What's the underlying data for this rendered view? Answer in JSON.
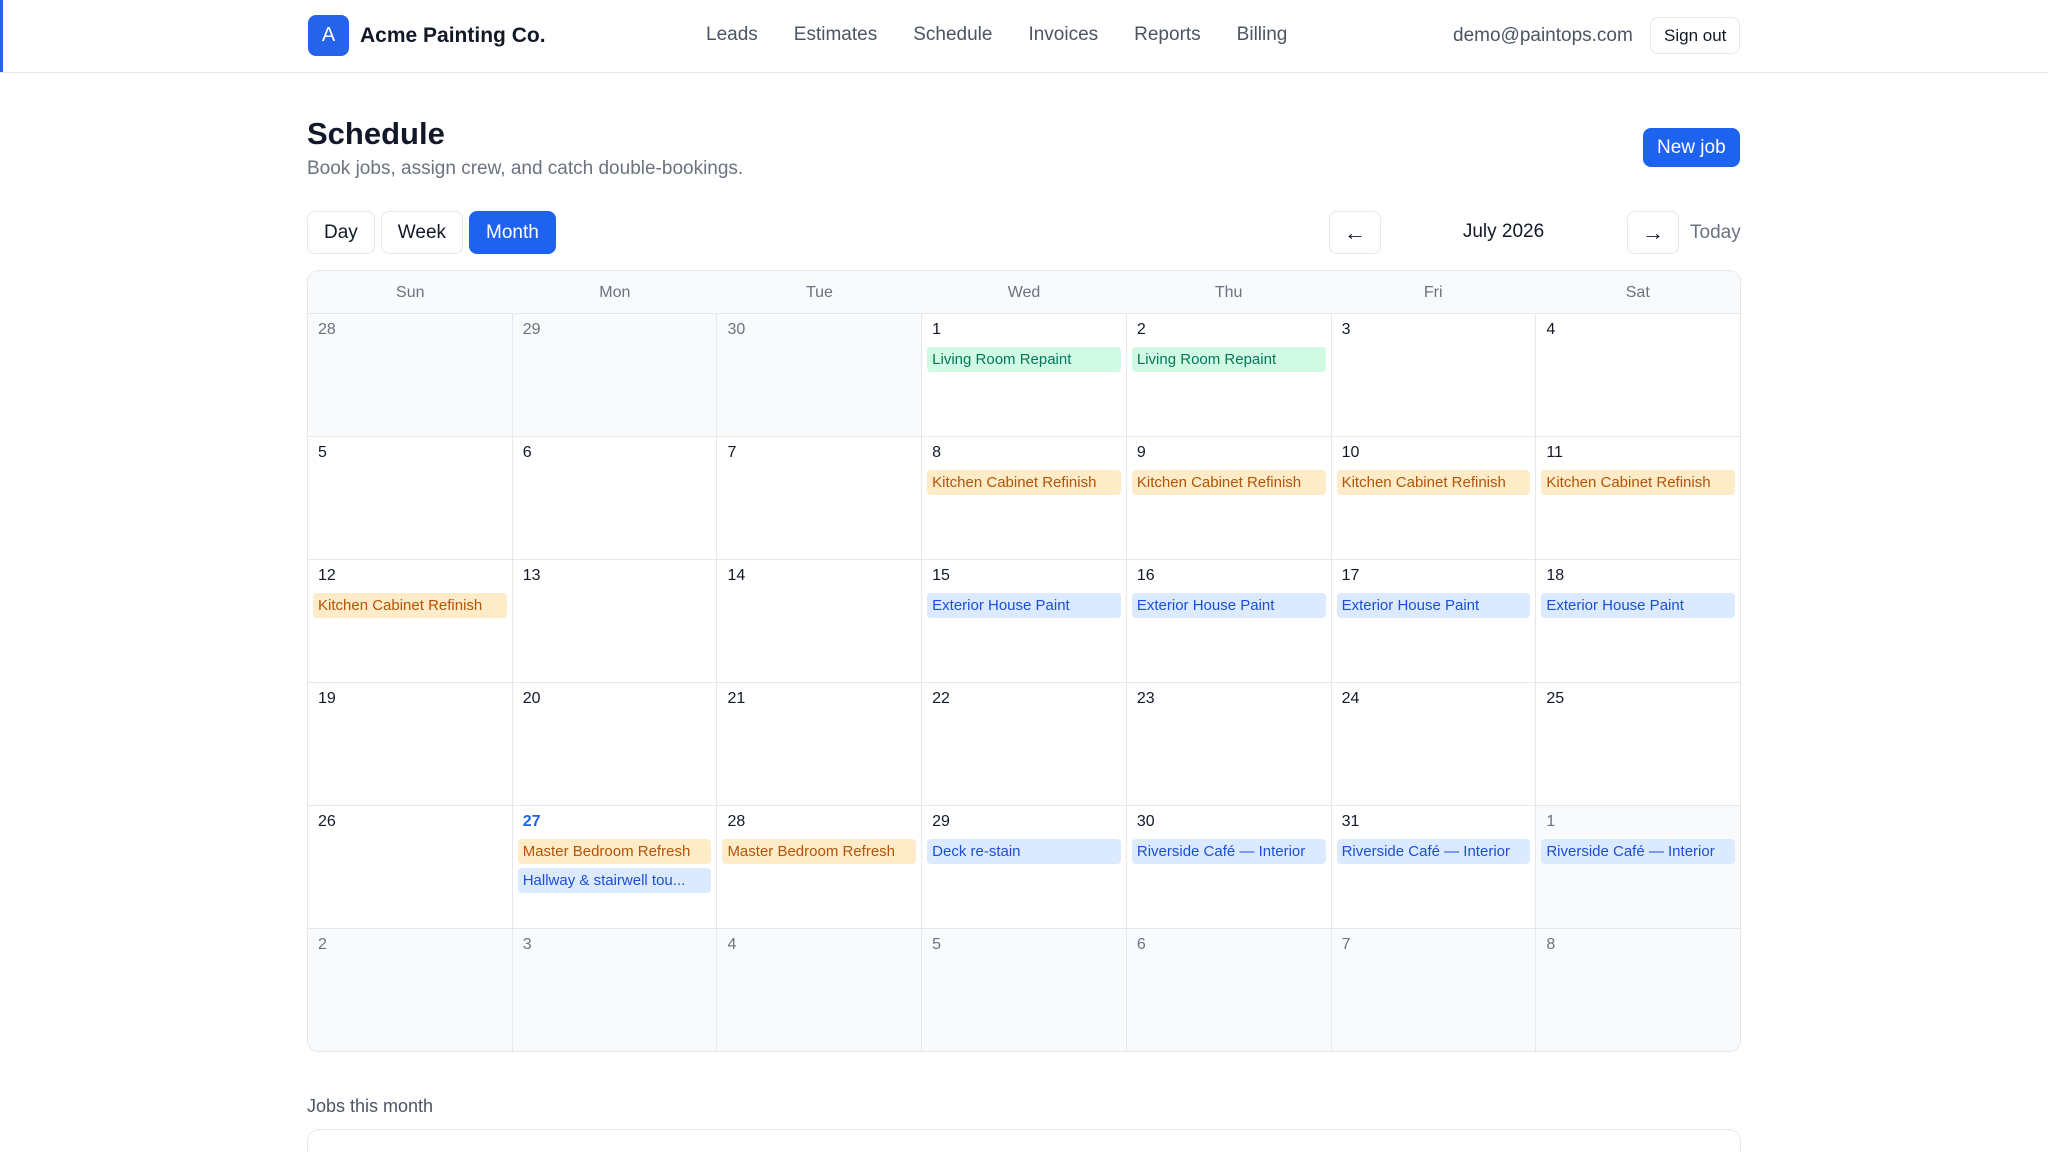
{
  "brand": {
    "logo_letter": "A",
    "name": "Acme Painting Co."
  },
  "nav": [
    {
      "label": "Leads"
    },
    {
      "label": "Estimates"
    },
    {
      "label": "Schedule"
    },
    {
      "label": "Invoices"
    },
    {
      "label": "Reports"
    },
    {
      "label": "Billing"
    }
  ],
  "user": {
    "email": "demo@paintops.com",
    "signout_label": "Sign out"
  },
  "page": {
    "title": "Schedule",
    "subtitle": "Book jobs, assign crew, and catch double-bookings.",
    "new_job_label": "New job"
  },
  "views": [
    {
      "label": "Day",
      "active": false
    },
    {
      "label": "Week",
      "active": false
    },
    {
      "label": "Month",
      "active": true
    }
  ],
  "month_nav": {
    "prev_icon": "←",
    "next_icon": "→",
    "label": "July 2026",
    "today_label": "Today"
  },
  "calendar": {
    "weekdays": [
      "Sun",
      "Mon",
      "Tue",
      "Wed",
      "Thu",
      "Fri",
      "Sat"
    ],
    "weeks": [
      [
        {
          "day": "28",
          "outside": true,
          "events": []
        },
        {
          "day": "29",
          "outside": true,
          "events": []
        },
        {
          "day": "30",
          "outside": true,
          "events": []
        },
        {
          "day": "1",
          "events": [
            {
              "label": "Living Room Repaint",
              "color": "green"
            }
          ]
        },
        {
          "day": "2",
          "events": [
            {
              "label": "Living Room Repaint",
              "color": "green"
            }
          ]
        },
        {
          "day": "3",
          "events": []
        },
        {
          "day": "4",
          "events": []
        }
      ],
      [
        {
          "day": "5",
          "events": []
        },
        {
          "day": "6",
          "events": []
        },
        {
          "day": "7",
          "events": []
        },
        {
          "day": "8",
          "events": [
            {
              "label": "Kitchen Cabinet Refinish",
              "color": "orange"
            }
          ]
        },
        {
          "day": "9",
          "events": [
            {
              "label": "Kitchen Cabinet Refinish",
              "color": "orange"
            }
          ]
        },
        {
          "day": "10",
          "events": [
            {
              "label": "Kitchen Cabinet Refinish",
              "color": "orange"
            }
          ]
        },
        {
          "day": "11",
          "events": [
            {
              "label": "Kitchen Cabinet Refinish",
              "color": "orange"
            }
          ]
        }
      ],
      [
        {
          "day": "12",
          "events": [
            {
              "label": "Kitchen Cabinet Refinish",
              "color": "orange"
            }
          ]
        },
        {
          "day": "13",
          "events": []
        },
        {
          "day": "14",
          "events": []
        },
        {
          "day": "15",
          "events": [
            {
              "label": "Exterior House Paint",
              "color": "blue"
            }
          ]
        },
        {
          "day": "16",
          "events": [
            {
              "label": "Exterior House Paint",
              "color": "blue"
            }
          ]
        },
        {
          "day": "17",
          "events": [
            {
              "label": "Exterior House Paint",
              "color": "blue"
            }
          ]
        },
        {
          "day": "18",
          "events": [
            {
              "label": "Exterior House Paint",
              "color": "blue"
            }
          ]
        }
      ],
      [
        {
          "day": "19",
          "events": []
        },
        {
          "day": "20",
          "events": []
        },
        {
          "day": "21",
          "events": []
        },
        {
          "day": "22",
          "events": []
        },
        {
          "day": "23",
          "events": []
        },
        {
          "day": "24",
          "events": []
        },
        {
          "day": "25",
          "events": []
        }
      ],
      [
        {
          "day": "26",
          "events": []
        },
        {
          "day": "27",
          "today": true,
          "events": [
            {
              "label": "Master Bedroom Refresh",
              "color": "orange"
            },
            {
              "label": "Hallway & stairwell tou...",
              "color": "blue"
            }
          ]
        },
        {
          "day": "28",
          "events": [
            {
              "label": "Master Bedroom Refresh",
              "color": "orange"
            }
          ]
        },
        {
          "day": "29",
          "events": [
            {
              "label": "Deck re-stain",
              "color": "blue"
            }
          ]
        },
        {
          "day": "30",
          "events": [
            {
              "label": "Riverside Café — Interior",
              "color": "blue"
            }
          ]
        },
        {
          "day": "31",
          "events": [
            {
              "label": "Riverside Café — Interior",
              "color": "blue"
            }
          ]
        },
        {
          "day": "1",
          "outside": true,
          "events": [
            {
              "label": "Riverside Café — Interior",
              "color": "blue"
            }
          ]
        }
      ],
      [
        {
          "day": "2",
          "outside": true,
          "events": []
        },
        {
          "day": "3",
          "outside": true,
          "events": []
        },
        {
          "day": "4",
          "outside": true,
          "events": []
        },
        {
          "day": "5",
          "outside": true,
          "events": []
        },
        {
          "day": "6",
          "outside": true,
          "events": []
        },
        {
          "day": "7",
          "outside": true,
          "events": []
        },
        {
          "day": "8",
          "outside": true,
          "events": []
        }
      ]
    ]
  },
  "jobs_section": {
    "title": "Jobs this month"
  },
  "colors": {
    "accent": "#1d63f0",
    "green_event": "#d1fae5",
    "orange_event": "#feecc8",
    "blue_event": "#dbeafe"
  }
}
